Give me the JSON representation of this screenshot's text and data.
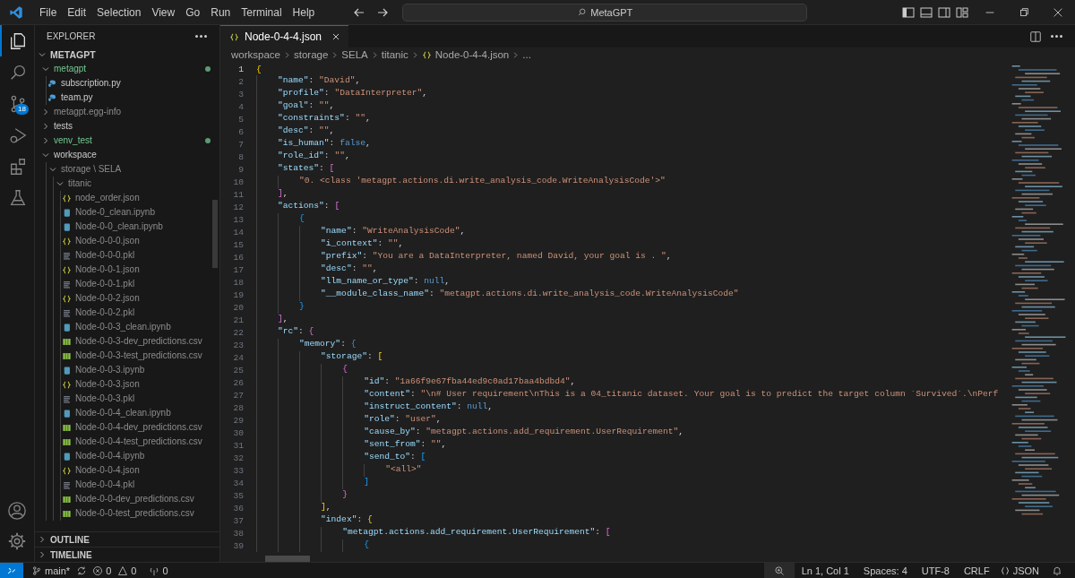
{
  "title_bar": {
    "menu": [
      "File",
      "Edit",
      "Selection",
      "View",
      "Go",
      "Run",
      "Terminal",
      "Help"
    ],
    "search": "MetaGPT"
  },
  "activity_bar": {
    "items": [
      {
        "kind": "explorer",
        "selected": true
      },
      {
        "kind": "search",
        "selected": false
      },
      {
        "kind": "source-control",
        "selected": false,
        "badge": "18"
      },
      {
        "kind": "run-debug",
        "selected": false
      },
      {
        "kind": "extensions",
        "selected": false
      },
      {
        "kind": "testing",
        "selected": false
      }
    ]
  },
  "sidebar": {
    "title": "EXPLORER",
    "root": "METAGPT",
    "tree": [
      {
        "label": "metagpt",
        "kind": "folder",
        "expanded": true,
        "ignored": false,
        "untracked": true,
        "children": [
          {
            "label": "subscription.py",
            "kind": "py",
            "ignored": false,
            "untracked": false
          },
          {
            "label": "team.py",
            "kind": "py",
            "ignored": false,
            "untracked": false
          }
        ]
      },
      {
        "label": "metagpt.egg-info",
        "kind": "folder",
        "expanded": false,
        "ignored": true,
        "untracked": false
      },
      {
        "label": "tests",
        "kind": "folder",
        "expanded": false,
        "ignored": false,
        "untracked": false
      },
      {
        "label": "venv_test",
        "kind": "folder",
        "expanded": false,
        "ignored": false,
        "untracked": true
      },
      {
        "label": "workspace",
        "kind": "folder",
        "expanded": true,
        "ignored": false,
        "untracked": false,
        "children": [
          {
            "label": "storage \\ SELA",
            "kind": "folder",
            "expanded": true,
            "ignored": true,
            "untracked": false,
            "children": [
              {
                "label": "titanic",
                "kind": "folder",
                "expanded": true,
                "ignored": true,
                "untracked": false,
                "children": [
                  {
                    "label": "node_order.json",
                    "kind": "json",
                    "ignored": true,
                    "untracked": false
                  },
                  {
                    "label": "Node-0_clean.ipynb",
                    "kind": "ipynb",
                    "ignored": true,
                    "untracked": false
                  },
                  {
                    "label": "Node-0-0_clean.ipynb",
                    "kind": "ipynb",
                    "ignored": true,
                    "untracked": false
                  },
                  {
                    "label": "Node-0-0-0.json",
                    "kind": "json",
                    "ignored": true,
                    "untracked": false
                  },
                  {
                    "label": "Node-0-0-0.pkl",
                    "kind": "pkl",
                    "ignored": true,
                    "untracked": false
                  },
                  {
                    "label": "Node-0-0-1.json",
                    "kind": "json",
                    "ignored": true,
                    "untracked": false
                  },
                  {
                    "label": "Node-0-0-1.pkl",
                    "kind": "pkl",
                    "ignored": true,
                    "untracked": false
                  },
                  {
                    "label": "Node-0-0-2.json",
                    "kind": "json",
                    "ignored": true,
                    "untracked": false
                  },
                  {
                    "label": "Node-0-0-2.pkl",
                    "kind": "pkl",
                    "ignored": true,
                    "untracked": false
                  },
                  {
                    "label": "Node-0-0-3_clean.ipynb",
                    "kind": "ipynb",
                    "ignored": true,
                    "untracked": false
                  },
                  {
                    "label": "Node-0-0-3-dev_predictions.csv",
                    "kind": "csv",
                    "ignored": true,
                    "untracked": false
                  },
                  {
                    "label": "Node-0-0-3-test_predictions.csv",
                    "kind": "csv",
                    "ignored": true,
                    "untracked": false
                  },
                  {
                    "label": "Node-0-0-3.ipynb",
                    "kind": "ipynb",
                    "ignored": true,
                    "untracked": false
                  },
                  {
                    "label": "Node-0-0-3.json",
                    "kind": "json",
                    "ignored": true,
                    "untracked": false
                  },
                  {
                    "label": "Node-0-0-3.pkl",
                    "kind": "pkl",
                    "ignored": true,
                    "untracked": false
                  },
                  {
                    "label": "Node-0-0-4_clean.ipynb",
                    "kind": "ipynb",
                    "ignored": true,
                    "untracked": false
                  },
                  {
                    "label": "Node-0-0-4-dev_predictions.csv",
                    "kind": "csv",
                    "ignored": true,
                    "untracked": false
                  },
                  {
                    "label": "Node-0-0-4-test_predictions.csv",
                    "kind": "csv",
                    "ignored": true,
                    "untracked": false
                  },
                  {
                    "label": "Node-0-0-4.ipynb",
                    "kind": "ipynb",
                    "ignored": true,
                    "untracked": false
                  },
                  {
                    "label": "Node-0-0-4.json",
                    "kind": "json",
                    "ignored": true,
                    "untracked": false
                  },
                  {
                    "label": "Node-0-0-4.pkl",
                    "kind": "pkl",
                    "ignored": true,
                    "untracked": false
                  },
                  {
                    "label": "Node-0-0-dev_predictions.csv",
                    "kind": "csv",
                    "ignored": true,
                    "untracked": false
                  },
                  {
                    "label": "Node-0-0-test_predictions.csv",
                    "kind": "csv",
                    "ignored": true,
                    "untracked": false
                  }
                ]
              }
            ]
          }
        ]
      }
    ],
    "sections": [
      {
        "label": "OUTLINE",
        "expanded": false
      },
      {
        "label": "TIMELINE",
        "expanded": false
      }
    ]
  },
  "editor": {
    "tabs": [
      {
        "label": "Node-0-4-4.json",
        "selected": true
      }
    ],
    "breadcrumbs": [
      "workspace",
      "storage",
      "SELA",
      "titanic",
      "Node-0-4-4.json",
      "..."
    ],
    "lines": [
      {
        "number": "1",
        "tokens": [
          {
            "kind": "b1",
            "text": "{"
          }
        ]
      },
      {
        "number": "2",
        "tokens": [
          {
            "kind": "key",
            "text": "    \"name\""
          },
          {
            "kind": "p",
            "text": ": "
          },
          {
            "kind": "str",
            "text": "\"David\""
          },
          {
            "kind": "p",
            "text": ","
          }
        ]
      },
      {
        "number": "3",
        "tokens": [
          {
            "kind": "key",
            "text": "    \"profile\""
          },
          {
            "kind": "p",
            "text": ": "
          },
          {
            "kind": "str",
            "text": "\"DataInterpreter\""
          },
          {
            "kind": "p",
            "text": ","
          }
        ]
      },
      {
        "number": "4",
        "tokens": [
          {
            "kind": "key",
            "text": "    \"goal\""
          },
          {
            "kind": "p",
            "text": ": "
          },
          {
            "kind": "str",
            "text": "\"\""
          },
          {
            "kind": "p",
            "text": ","
          }
        ]
      },
      {
        "number": "5",
        "tokens": [
          {
            "kind": "key",
            "text": "    \"constraints\""
          },
          {
            "kind": "p",
            "text": ": "
          },
          {
            "kind": "str",
            "text": "\"\""
          },
          {
            "kind": "p",
            "text": ","
          }
        ]
      },
      {
        "number": "6",
        "tokens": [
          {
            "kind": "key",
            "text": "    \"desc\""
          },
          {
            "kind": "p",
            "text": ": "
          },
          {
            "kind": "str",
            "text": "\"\""
          },
          {
            "kind": "p",
            "text": ","
          }
        ]
      },
      {
        "number": "7",
        "tokens": [
          {
            "kind": "key",
            "text": "    \"is_human\""
          },
          {
            "kind": "p",
            "text": ": "
          },
          {
            "kind": "kw",
            "text": "false"
          },
          {
            "kind": "p",
            "text": ","
          }
        ]
      },
      {
        "number": "8",
        "tokens": [
          {
            "kind": "key",
            "text": "    \"role_id\""
          },
          {
            "kind": "p",
            "text": ": "
          },
          {
            "kind": "str",
            "text": "\"\""
          },
          {
            "kind": "p",
            "text": ","
          }
        ]
      },
      {
        "number": "9",
        "tokens": [
          {
            "kind": "key",
            "text": "    \"states\""
          },
          {
            "kind": "p",
            "text": ": "
          },
          {
            "kind": "b2",
            "text": "["
          }
        ]
      },
      {
        "number": "10",
        "tokens": [
          {
            "kind": "str",
            "text": "        \"0. <class 'metagpt.actions.di.write_analysis_code.WriteAnalysisCode'>\""
          }
        ]
      },
      {
        "number": "11",
        "tokens": [
          {
            "kind": "b2",
            "text": "    ]"
          },
          {
            "kind": "p",
            "text": ","
          }
        ]
      },
      {
        "number": "12",
        "tokens": [
          {
            "kind": "key",
            "text": "    \"actions\""
          },
          {
            "kind": "p",
            "text": ": "
          },
          {
            "kind": "b2",
            "text": "["
          }
        ]
      },
      {
        "number": "13",
        "tokens": [
          {
            "kind": "b3",
            "text": "        {"
          }
        ]
      },
      {
        "number": "14",
        "tokens": [
          {
            "kind": "key",
            "text": "            \"name\""
          },
          {
            "kind": "p",
            "text": ": "
          },
          {
            "kind": "str",
            "text": "\"WriteAnalysisCode\""
          },
          {
            "kind": "p",
            "text": ","
          }
        ]
      },
      {
        "number": "15",
        "tokens": [
          {
            "kind": "key",
            "text": "            \"i_context\""
          },
          {
            "kind": "p",
            "text": ": "
          },
          {
            "kind": "str",
            "text": "\"\""
          },
          {
            "kind": "p",
            "text": ","
          }
        ]
      },
      {
        "number": "16",
        "tokens": [
          {
            "kind": "key",
            "text": "            \"prefix\""
          },
          {
            "kind": "p",
            "text": ": "
          },
          {
            "kind": "str",
            "text": "\"You are a DataInterpreter, named David, your goal is . \""
          },
          {
            "kind": "p",
            "text": ","
          }
        ]
      },
      {
        "number": "17",
        "tokens": [
          {
            "kind": "key",
            "text": "            \"desc\""
          },
          {
            "kind": "p",
            "text": ": "
          },
          {
            "kind": "str",
            "text": "\"\""
          },
          {
            "kind": "p",
            "text": ","
          }
        ]
      },
      {
        "number": "18",
        "tokens": [
          {
            "kind": "key",
            "text": "            \"llm_name_or_type\""
          },
          {
            "kind": "p",
            "text": ": "
          },
          {
            "kind": "kw",
            "text": "null"
          },
          {
            "kind": "p",
            "text": ","
          }
        ]
      },
      {
        "number": "19",
        "tokens": [
          {
            "kind": "key",
            "text": "            \"__module_class_name\""
          },
          {
            "kind": "p",
            "text": ": "
          },
          {
            "kind": "str",
            "text": "\"metagpt.actions.di.write_analysis_code.WriteAnalysisCode\""
          }
        ]
      },
      {
        "number": "20",
        "tokens": [
          {
            "kind": "b3",
            "text": "        }"
          }
        ]
      },
      {
        "number": "21",
        "tokens": [
          {
            "kind": "b2",
            "text": "    ]"
          },
          {
            "kind": "p",
            "text": ","
          }
        ]
      },
      {
        "number": "22",
        "tokens": [
          {
            "kind": "key",
            "text": "    \"rc\""
          },
          {
            "kind": "p",
            "text": ": "
          },
          {
            "kind": "b2",
            "text": "{"
          }
        ]
      },
      {
        "number": "23",
        "tokens": [
          {
            "kind": "key",
            "text": "        \"memory\""
          },
          {
            "kind": "p",
            "text": ": "
          },
          {
            "kind": "b3",
            "text": "{"
          }
        ]
      },
      {
        "number": "24",
        "tokens": [
          {
            "kind": "key",
            "text": "            \"storage\""
          },
          {
            "kind": "p",
            "text": ": "
          },
          {
            "kind": "b1",
            "text": "["
          }
        ]
      },
      {
        "number": "25",
        "tokens": [
          {
            "kind": "b2",
            "text": "                {"
          }
        ]
      },
      {
        "number": "26",
        "tokens": [
          {
            "kind": "key",
            "text": "                    \"id\""
          },
          {
            "kind": "p",
            "text": ": "
          },
          {
            "kind": "str",
            "text": "\"1a66f9e67fba44ed9c0ad17baa4bdbd4\""
          },
          {
            "kind": "p",
            "text": ","
          }
        ]
      },
      {
        "number": "27",
        "tokens": [
          {
            "kind": "key",
            "text": "                    \"content\""
          },
          {
            "kind": "p",
            "text": ": "
          },
          {
            "kind": "str",
            "text": "\"\\n# User requirement\\nThis is a 04_titanic dataset. Your goal is to predict the target column `Survived`.\\nPerf"
          }
        ]
      },
      {
        "number": "28",
        "tokens": [
          {
            "kind": "key",
            "text": "                    \"instruct_content\""
          },
          {
            "kind": "p",
            "text": ": "
          },
          {
            "kind": "kw",
            "text": "null"
          },
          {
            "kind": "p",
            "text": ","
          }
        ]
      },
      {
        "number": "29",
        "tokens": [
          {
            "kind": "key",
            "text": "                    \"role\""
          },
          {
            "kind": "p",
            "text": ": "
          },
          {
            "kind": "str",
            "text": "\"user\""
          },
          {
            "kind": "p",
            "text": ","
          }
        ]
      },
      {
        "number": "30",
        "tokens": [
          {
            "kind": "key",
            "text": "                    \"cause_by\""
          },
          {
            "kind": "p",
            "text": ": "
          },
          {
            "kind": "str",
            "text": "\"metagpt.actions.add_requirement.UserRequirement\""
          },
          {
            "kind": "p",
            "text": ","
          }
        ]
      },
      {
        "number": "31",
        "tokens": [
          {
            "kind": "key",
            "text": "                    \"sent_from\""
          },
          {
            "kind": "p",
            "text": ": "
          },
          {
            "kind": "str",
            "text": "\"\""
          },
          {
            "kind": "p",
            "text": ","
          }
        ]
      },
      {
        "number": "32",
        "tokens": [
          {
            "kind": "key",
            "text": "                    \"send_to\""
          },
          {
            "kind": "p",
            "text": ": "
          },
          {
            "kind": "b3",
            "text": "["
          }
        ]
      },
      {
        "number": "33",
        "tokens": [
          {
            "kind": "str",
            "text": "                        \"<all>\""
          }
        ]
      },
      {
        "number": "34",
        "tokens": [
          {
            "kind": "b3",
            "text": "                    ]"
          }
        ]
      },
      {
        "number": "35",
        "tokens": [
          {
            "kind": "b2",
            "text": "                }"
          }
        ]
      },
      {
        "number": "36",
        "tokens": [
          {
            "kind": "b1",
            "text": "            ]"
          },
          {
            "kind": "p",
            "text": ","
          }
        ]
      },
      {
        "number": "37",
        "tokens": [
          {
            "kind": "key",
            "text": "            \"index\""
          },
          {
            "kind": "p",
            "text": ": "
          },
          {
            "kind": "b1",
            "text": "{"
          }
        ]
      },
      {
        "number": "38",
        "tokens": [
          {
            "kind": "key",
            "text": "                \"metagpt.actions.add_requirement.UserRequirement\""
          },
          {
            "kind": "p",
            "text": ": "
          },
          {
            "kind": "b2",
            "text": "["
          }
        ]
      },
      {
        "number": "39",
        "tokens": [
          {
            "kind": "b3",
            "text": "                    {"
          }
        ]
      }
    ]
  },
  "status_bar": {
    "branch": "main*",
    "errors": "0",
    "warnings": "0",
    "ports": "0",
    "position": "Ln 1, Col 1",
    "indent": "Spaces: 4",
    "encoding": "UTF-8",
    "eol": "CRLF",
    "language": "JSON"
  }
}
